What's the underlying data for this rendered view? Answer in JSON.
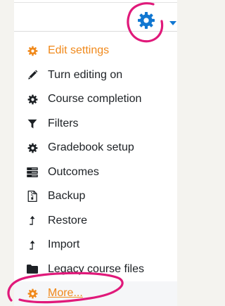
{
  "menu": {
    "trigger_icon": "gear-icon",
    "items": [
      {
        "label": "Edit settings",
        "icon": "gear-icon"
      },
      {
        "label": "Turn editing on",
        "icon": "pencil-icon"
      },
      {
        "label": "Course completion",
        "icon": "gear-icon"
      },
      {
        "label": "Filters",
        "icon": "filter-icon"
      },
      {
        "label": "Gradebook setup",
        "icon": "gear-icon"
      },
      {
        "label": "Outcomes",
        "icon": "outcomes-icon"
      },
      {
        "label": "Backup",
        "icon": "file-archive-icon"
      },
      {
        "label": "Restore",
        "icon": "level-up-icon"
      },
      {
        "label": "Import",
        "icon": "level-up-icon"
      },
      {
        "label": "Legacy course files",
        "icon": "folder-icon"
      },
      {
        "label": "More...",
        "icon": "gear-icon"
      }
    ]
  },
  "colors": {
    "accent_orange": "#f0891b",
    "gear_blue": "#1177d1",
    "annotation_pink": "#e0197a",
    "text": "#1d2125"
  }
}
